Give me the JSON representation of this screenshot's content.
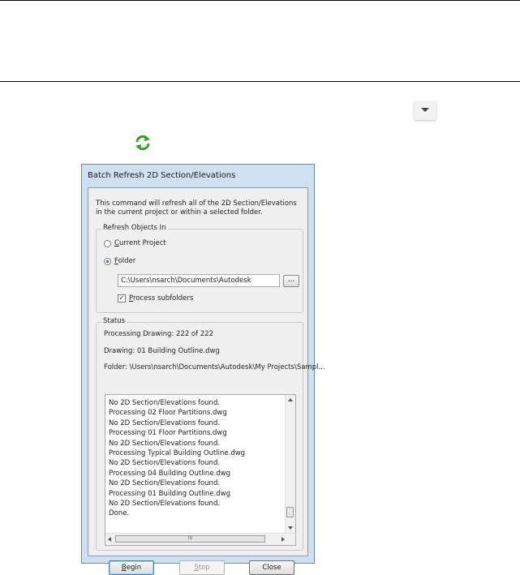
{
  "dialog": {
    "title": "Batch Refresh 2D Section/Elevations",
    "intro": "This command will refresh all of the 2D Section/Elevations in the current project or within a selected folder.",
    "refresh_group": {
      "legend": "Refresh Objects In",
      "current_project_label": "Current Project",
      "folder_label": "Folder",
      "selected": "Folder",
      "folder_path": "C:\\Users\\nsarch\\Documents\\Autodesk",
      "browse_label": "...",
      "process_subfolders_label": "Process subfolders",
      "process_subfolders_checked": true
    },
    "status_group": {
      "legend": "Status",
      "processing_drawing": "Processing Drawing: 222 of 222",
      "drawing": "Drawing: 01 Building Outline.dwg",
      "folder": "Folder: \\Users\\nsarch\\Documents\\Autodesk\\My Projects\\Sampl..."
    },
    "log": [
      "No 2D Section/Elevations found.",
      "Processing 02 Floor Partitions.dwg",
      "No 2D Section/Elevations found.",
      "Processing 01 Floor Partitions.dwg",
      "No 2D Section/Elevations found.",
      "Processing Typical Building Outline.dwg",
      "No 2D Section/Elevations found.",
      "Processing 04 Building Outline.dwg",
      "No 2D Section/Elevations found.",
      "Processing 01 Building Outline.dwg",
      "No 2D Section/Elevations found.",
      "Done."
    ],
    "hscroll_grip": "III",
    "buttons": {
      "begin": "Begin",
      "stop": "Stop",
      "close": "Close"
    }
  },
  "icons": {
    "dropdown": "dropdown-arrow-icon",
    "refresh": "refresh-icon"
  },
  "colors": {
    "refresh_icon": "#3a9a2a",
    "dialog_frame": "#cfe0f1"
  }
}
